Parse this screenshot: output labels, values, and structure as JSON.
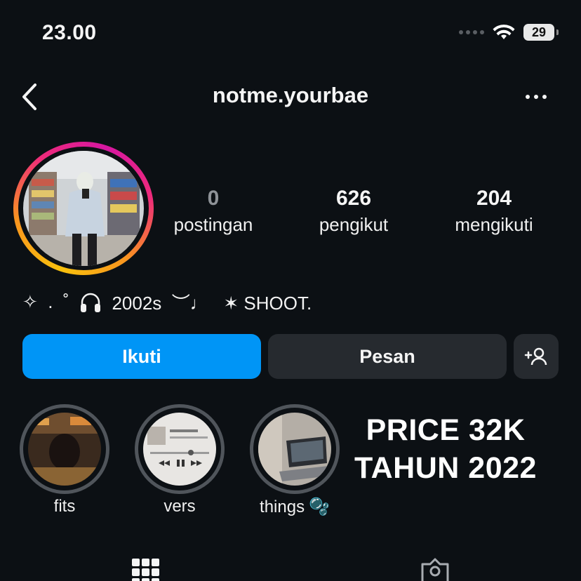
{
  "status_bar": {
    "time": "23.00",
    "battery": "29"
  },
  "header": {
    "username": "notme.yourbae"
  },
  "profile": {
    "stats": [
      {
        "value": "0",
        "label": "postingan",
        "dim": true
      },
      {
        "value": "626",
        "label": "pengikut",
        "dim": false
      },
      {
        "value": "204",
        "label": "mengikuti",
        "dim": false
      }
    ],
    "bio": {
      "part1": "✧  .  ˚  ",
      "part2": "  2002s  ︶♩   ✶ SHOOT."
    }
  },
  "actions": {
    "follow_label": "Ikuti",
    "message_label": "Pesan"
  },
  "highlights": [
    {
      "label": "fits"
    },
    {
      "label": "vers"
    },
    {
      "label": "things",
      "emoji": "🫧"
    }
  ],
  "overlay": {
    "line1": "PRICE 32K",
    "line2": "TAHUN 2022"
  },
  "colors": {
    "accent": "#0095f6",
    "background": "#0c1014",
    "button_bg": "#262a2f"
  },
  "icons": [
    "back-icon",
    "more-icon",
    "wifi-icon",
    "battery-icon",
    "add-person-icon",
    "grid-icon",
    "tagged-icon",
    "headphones-icon"
  ]
}
